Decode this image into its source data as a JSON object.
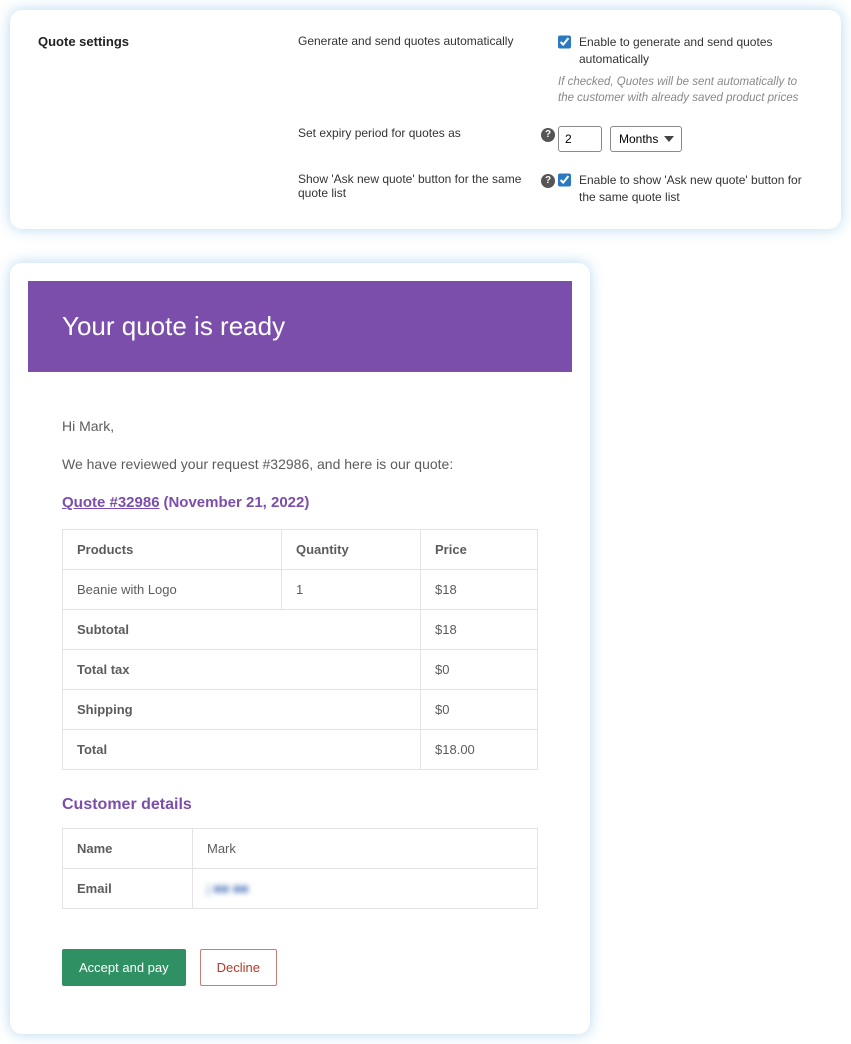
{
  "settings": {
    "section_title": "Quote settings",
    "rows": {
      "auto": {
        "label": "Generate and send quotes automatically",
        "checkbox_label": "Enable to generate and send quotes automatically",
        "help_text": "If checked, Quotes will be sent automatically to the customer with already saved product prices",
        "checked": true
      },
      "expiry": {
        "label": "Set expiry period for quotes as",
        "value": "2",
        "unit": "Months"
      },
      "asknew": {
        "label": "Show 'Ask new quote' button for the same quote list",
        "checkbox_label": "Enable to show 'Ask new quote' button for the same quote list",
        "checked": true
      }
    }
  },
  "email": {
    "header": "Your quote is ready",
    "greeting": "Hi Mark,",
    "intro": "We have reviewed your request #32986, and here is our quote:",
    "quote_link": "Quote #32986",
    "quote_date": "(November 21, 2022)",
    "table": {
      "headers": {
        "products": "Products",
        "qty": "Quantity",
        "price": "Price"
      },
      "items": [
        {
          "name": "Beanie with Logo",
          "qty": "1",
          "price": "$18"
        }
      ],
      "totals": [
        {
          "label": "Subtotal",
          "value": "$18"
        },
        {
          "label": "Total tax",
          "value": "$0"
        },
        {
          "label": "Shipping",
          "value": "$0"
        },
        {
          "label": "Total",
          "value": "$18.00"
        }
      ]
    },
    "customer": {
      "heading": "Customer details",
      "fields": {
        "name_label": "Name",
        "name_value": "Mark",
        "email_label": "Email",
        "email_value": "j ■■ ■■"
      }
    },
    "buttons": {
      "accept": "Accept and pay",
      "decline": "Decline"
    }
  }
}
